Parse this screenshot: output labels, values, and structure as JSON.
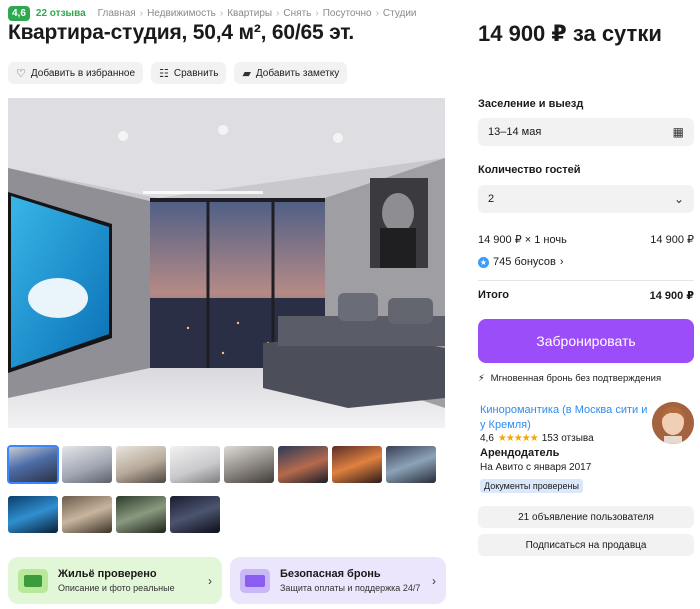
{
  "header": {
    "rating": "4,6",
    "reviews": "22 отзыва",
    "breadcrumbs": [
      "Главная",
      "Недвижимость",
      "Квартиры",
      "Снять",
      "Посуточно",
      "Студии"
    ],
    "title": "Квартира-студия, 50,4 м², 60/65 эт.",
    "price": "14 900 ₽ за сутки"
  },
  "actions": {
    "favorite": "Добавить в избранное",
    "compare": "Сравнить",
    "note": "Добавить заметку"
  },
  "gallery": {
    "thumb_count": 12,
    "active_index": 0
  },
  "booking": {
    "dates_label": "Заселение и выезд",
    "dates_value": "13–14 мая",
    "guests_label": "Количество гостей",
    "guests_value": "2",
    "nights_label": "14 900 ₽ × 1 ночь",
    "nights_value": "14 900 ₽",
    "bonus": "745 бонусов",
    "total_label": "Итого",
    "total_value": "14 900 ₽",
    "book_button": "Забронировать",
    "instant_note": "Мгновенная бронь без подтверждения"
  },
  "seller": {
    "name": "Киноромантика (в Москва сити и у Кремля)",
    "rating": "4,6",
    "reviews": "153 отзыва",
    "role": "Арендодатель",
    "since": "На Авито с января 2017",
    "docs_badge": "Документы проверены",
    "listings_button": "21 объявление пользователя",
    "subscribe_button": "Подписаться на продавца"
  },
  "promos": {
    "verified_title": "Жильё проверено",
    "verified_sub": "Описание и фото реальные",
    "safe_title": "Безопасная бронь",
    "safe_sub": "Защита оплаты и поддержка 24/7"
  },
  "colors": {
    "accent_green": "#2fa84f",
    "book_purple": "#9b4dfa",
    "link_blue": "#2d8cf0"
  }
}
